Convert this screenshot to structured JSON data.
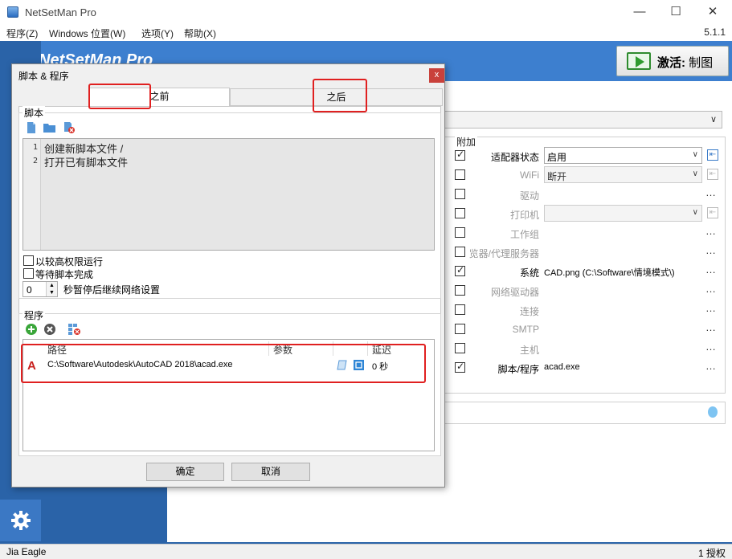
{
  "window": {
    "title": "NetSetMan Pro",
    "minimize": "—",
    "maximize": "☐",
    "close": "✕",
    "version": "5.1.1"
  },
  "menu": [
    "程序(Z)",
    "Windows 位置(W)",
    "选项(Y)",
    "帮助(X)"
  ],
  "header": {
    "brand": "NetSetMan Pro",
    "activate_bold": "激活:",
    "activate_rest": " 制图"
  },
  "addons": {
    "title": "附加",
    "rows": [
      {
        "label": "适配器状态",
        "checked": true,
        "dim": false,
        "value": "启用",
        "kind": "select",
        "action": "ext"
      },
      {
        "label": "WiFi",
        "checked": false,
        "dim": true,
        "value": "断开",
        "kind": "select-dim",
        "action": "ext-dim"
      },
      {
        "label": "驱动",
        "checked": false,
        "dim": true,
        "value": "",
        "kind": "none",
        "action": "dots"
      },
      {
        "label": "打印机",
        "checked": false,
        "dim": true,
        "value": "",
        "kind": "select-dim",
        "action": "ext-dim"
      },
      {
        "label": "工作组",
        "checked": false,
        "dim": true,
        "value": "",
        "kind": "none",
        "action": "dots"
      },
      {
        "label": "览器/代理服务器",
        "checked": false,
        "dim": true,
        "value": "",
        "kind": "none",
        "action": "dots"
      },
      {
        "label": "系统",
        "checked": true,
        "dim": false,
        "value": "CAD.png (C:\\Software\\情境模式\\)",
        "kind": "text",
        "action": "dots"
      },
      {
        "label": "网络驱动器",
        "checked": false,
        "dim": true,
        "value": "",
        "kind": "none",
        "action": "dots"
      },
      {
        "label": "连接",
        "checked": false,
        "dim": true,
        "value": "",
        "kind": "none",
        "action": "dots"
      },
      {
        "label": "SMTP",
        "checked": false,
        "dim": true,
        "value": "",
        "kind": "none",
        "action": "dots"
      },
      {
        "label": "主机",
        "checked": false,
        "dim": true,
        "value": "",
        "kind": "none",
        "action": "dots"
      },
      {
        "label": "脚本/程序",
        "checked": true,
        "dim": false,
        "value": "acad.exe",
        "kind": "text",
        "action": "dots"
      }
    ]
  },
  "statusbar": {
    "user": "Jia Eagle",
    "license": "1 授权"
  },
  "dialog": {
    "title": "脚本 & 程序",
    "close": "x",
    "tabs": [
      "之前",
      "之后"
    ],
    "script_group": "脚本",
    "script_lines": [
      "创建新脚本文件 /",
      "打开已有脚本文件"
    ],
    "run_elevated": "以较高权限运行",
    "wait_complete": "等待脚本完成",
    "pause_value": "0",
    "pause_label": "秒暂停后继续网络设置",
    "program_group": "程序",
    "columns": [
      "路径",
      "参数",
      "延迟"
    ],
    "programs": [
      {
        "icon": "A",
        "path": "C:\\Software\\Autodesk\\AutoCAD 2018\\acad.exe",
        "params": "",
        "delay": "0 秒"
      }
    ],
    "ok": "确定",
    "cancel": "取消"
  },
  "colors": {
    "accent_blue": "#2a63a8",
    "header_blue": "#3d7fcf",
    "highlight_red": "#e02020",
    "add_green": "#3aa63a"
  }
}
